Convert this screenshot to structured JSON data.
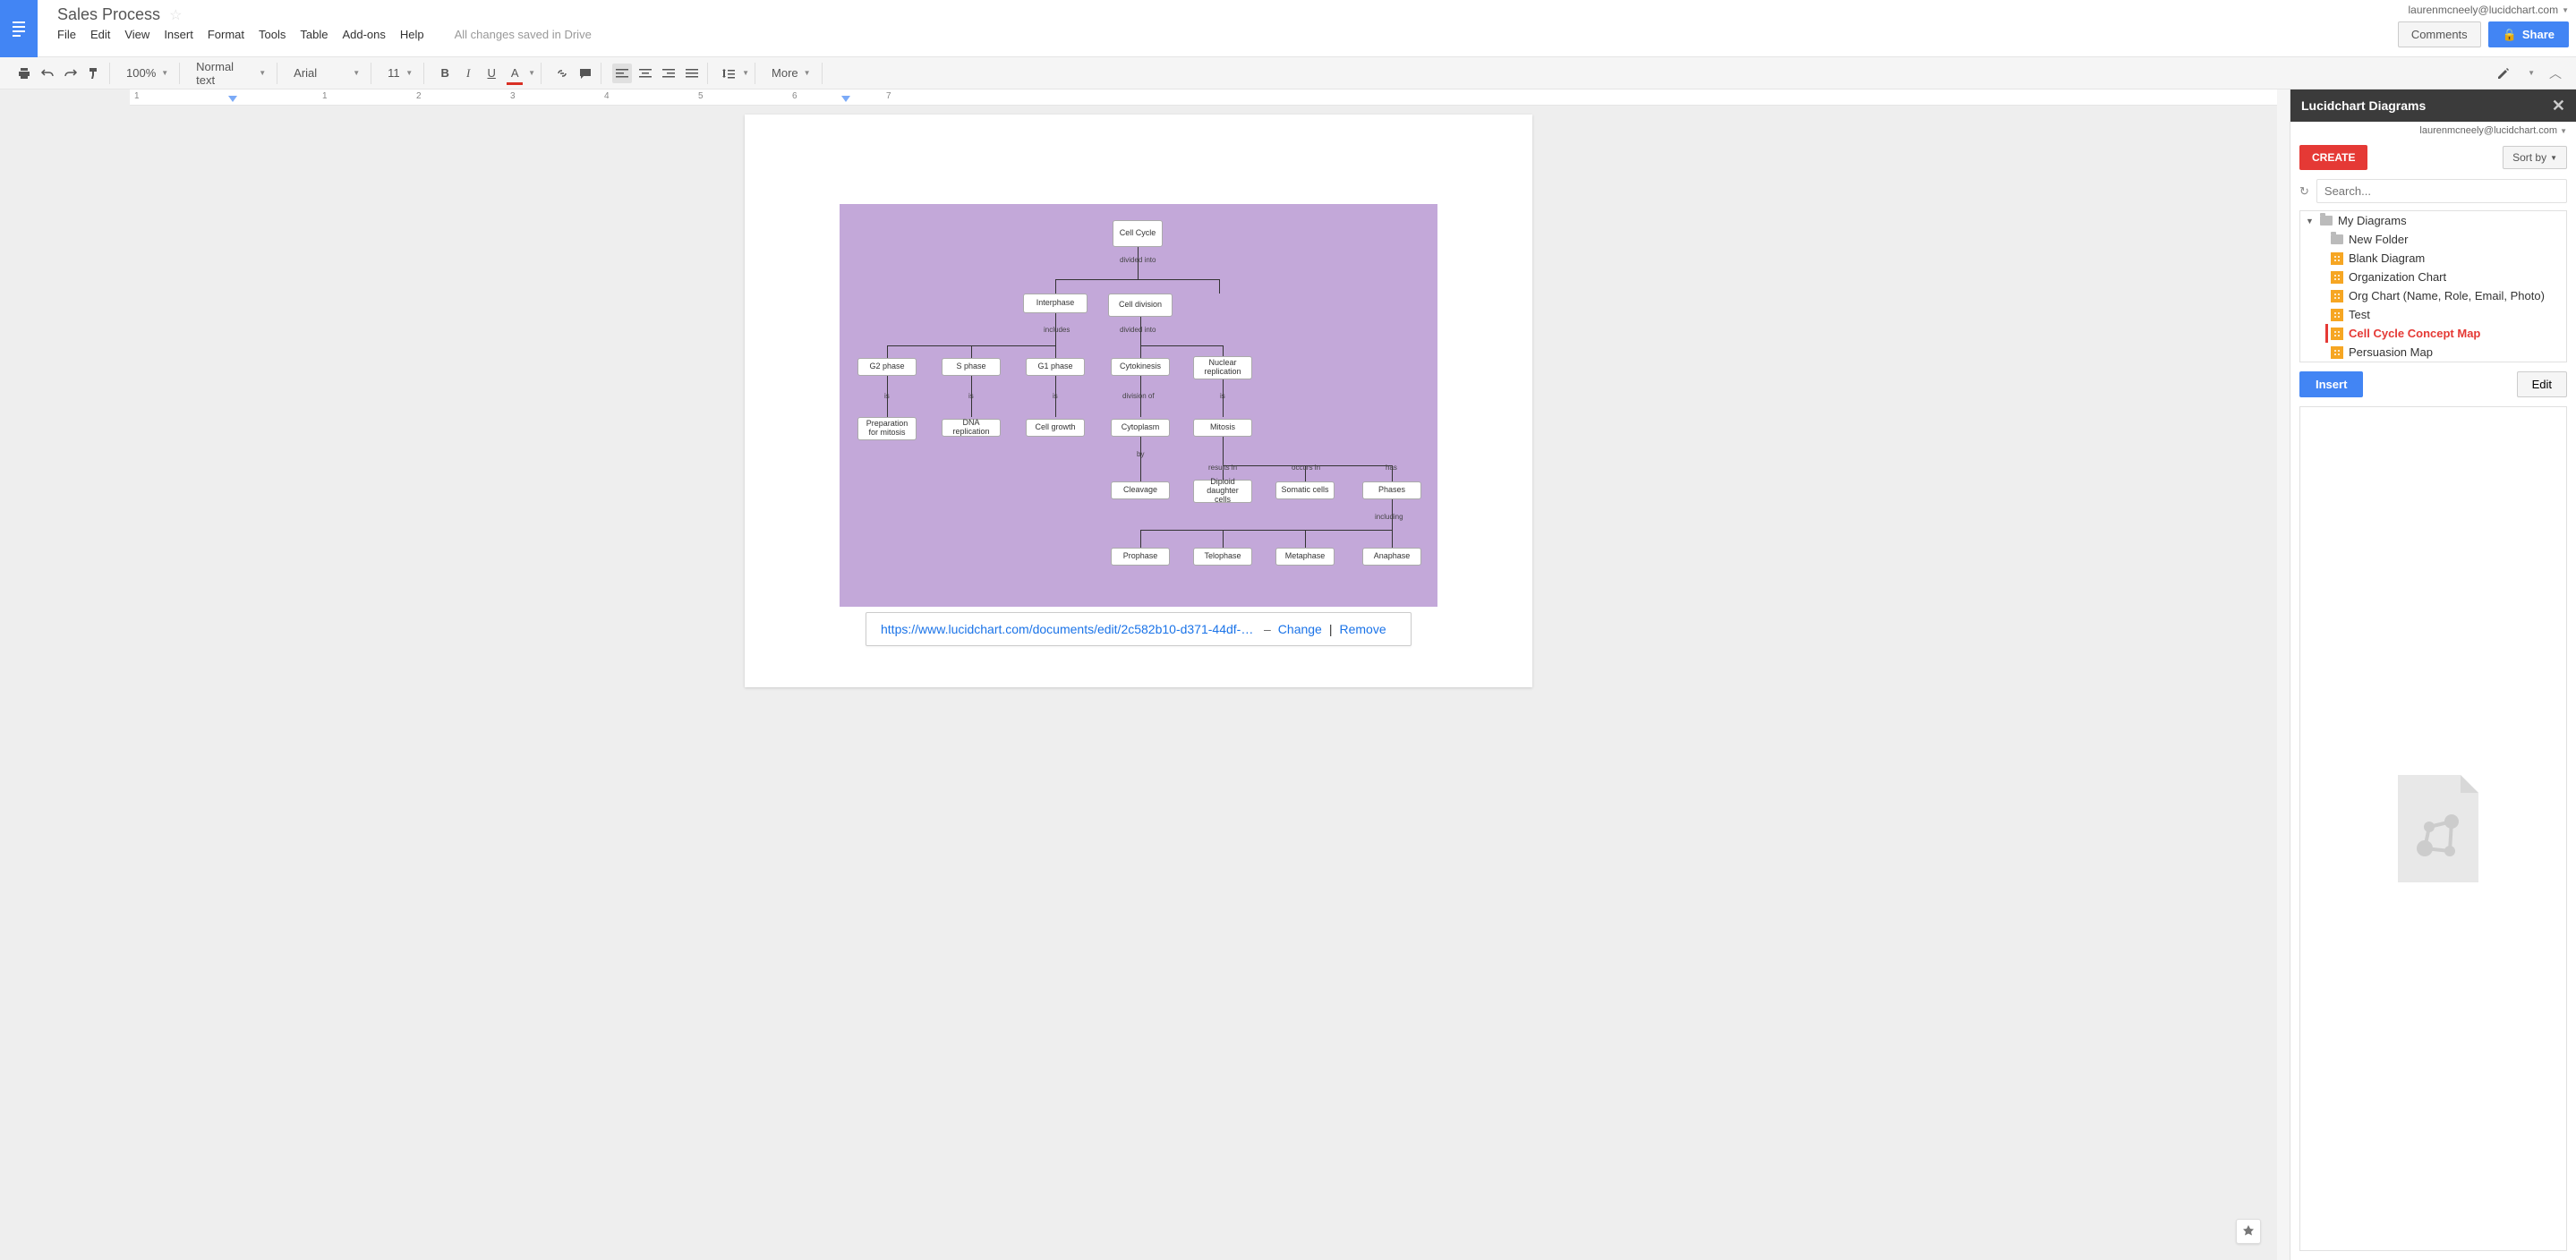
{
  "doc": {
    "title": "Sales Process",
    "status": "All changes saved in Drive"
  },
  "user": {
    "email_google": "laurenmcneely@lucidchart.com",
    "email_lucid": "laurenmcneely@lucidchart.com"
  },
  "menus": [
    "File",
    "Edit",
    "View",
    "Insert",
    "Format",
    "Tools",
    "Table",
    "Add-ons",
    "Help"
  ],
  "header_buttons": {
    "comments": "Comments",
    "share": "Share"
  },
  "toolbar": {
    "zoom": "100%",
    "style": "Normal text",
    "font": "Arial",
    "size": "11",
    "more": "More"
  },
  "ruler": {
    "ticks": [
      "1",
      "1",
      "2",
      "3",
      "4",
      "5",
      "6",
      "7"
    ]
  },
  "diagram": {
    "nodes": {
      "root": "Cell Cycle",
      "interphase": "Interphase",
      "celldiv": "Cell division",
      "g2": "G2 phase",
      "s": "S phase",
      "g1": "G1 phase",
      "cyto": "Cytokinesis",
      "nuc": "Nuclear replication",
      "prep": "Preparation for mitosis",
      "dna": "DNA replication",
      "grow": "Cell growth",
      "cytop": "Cytoplasm",
      "mito": "Mitosis",
      "cleav": "Cleavage",
      "dip": "Diploid daughter cells",
      "som": "Somatic cells",
      "phases": "Phases",
      "pro": "Prophase",
      "telo": "Telophase",
      "meta": "Metaphase",
      "ana": "Anaphase"
    },
    "labels": {
      "div1": "divided into",
      "incl": "includes",
      "div2": "divided into",
      "is1": "is",
      "is2": "is",
      "is3": "is",
      "divof": "division of",
      "is4": "is",
      "by": "by",
      "res": "results in",
      "occ": "occurs in",
      "has": "has",
      "including": "including"
    }
  },
  "linkbar": {
    "url": "https://www.lucidchart.com/documents/edit/2c582b10-d371-44df-b…",
    "change": "Change",
    "remove": "Remove",
    "sep": "|",
    "dash": "–"
  },
  "sidebar": {
    "title": "Lucidchart Diagrams",
    "create": "CREATE",
    "sort": "Sort by",
    "search_placeholder": "Search...",
    "root": "My Diagrams",
    "folder": "New Folder",
    "items": [
      "Blank Diagram",
      "Organization Chart",
      "Org Chart (Name, Role, Email, Photo)",
      "Test",
      "Cell Cycle Concept Map",
      "Persuasion Map"
    ],
    "selected_index": 4,
    "insert": "Insert",
    "edit": "Edit"
  }
}
